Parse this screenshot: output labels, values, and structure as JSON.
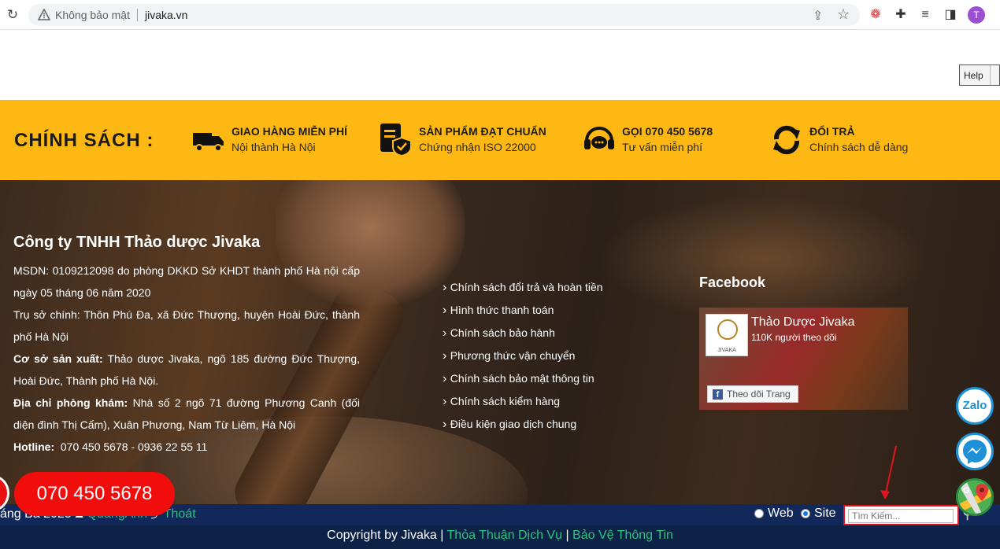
{
  "browser": {
    "security_label": "Không bảo mật",
    "url": "jivaka.vn",
    "avatar_initial": "T"
  },
  "help": {
    "label": "Help"
  },
  "policy": {
    "heading": "CHÍNH SÁCH :",
    "items": [
      {
        "icon": "truck-icon",
        "title": "GIAO HÀNG MIỄN PHÍ",
        "subtitle": "Nội thành Hà Nội"
      },
      {
        "icon": "certificate-icon",
        "title": "SẢN PHẨM ĐẠT CHUẨN",
        "subtitle": "Chứng nhận ISO 22000"
      },
      {
        "icon": "headset-icon",
        "title": "GỌI 070 450 5678",
        "subtitle": "Tư vấn miễn phí"
      },
      {
        "icon": "refresh-icon",
        "title": "ĐỔI TRẢ",
        "subtitle": "Chính sách dễ dàng"
      }
    ]
  },
  "company": {
    "name": "Công ty TNHH Thảo dược Jivaka",
    "msdn": "MSDN: 0109212098 do phòng DKKD Sở KHDT thành phố Hà nội cấp ngày 05 tháng 06 năm 2020",
    "head_office": "Trụ sở chính: Thôn Phú Đa, xã Đức Thượng, huyện Hoài Đức, thành phố Hà Nội",
    "factory_label": "Cơ sở sản xuất:",
    "factory": "Thảo dược Jivaka, ngõ 185 đường Đức Thượng, Hoài Đức, Thành phố Hà Nội.",
    "clinic_label": "Địa chỉ phòng khám:",
    "clinic": "Nhà số 2 ngõ 71 đường Phương Canh (đối diện đình Thị Cấm), Xuân Phương, Nam Từ Liêm, Hà Nội",
    "hotline_label": "Hotline:",
    "hotline": "070 450 5678 - 0936 22 55 11"
  },
  "links": [
    "Chính sách đổi trả và hoàn tiền",
    "Hình thức thanh toán",
    "Chính sách bảo hành",
    "Phương thức vận chuyển",
    "Chính sách bảo mật thông tin",
    "Chính sách kiểm hàng",
    "Điều kiện giao dịch chung"
  ],
  "facebook": {
    "title": "Facebook",
    "page_name": "Thảo Dược Jivaka",
    "followers": "110K người theo dõi",
    "logo_text": "JIVAKA",
    "follow_label": "Theo dõi Trang"
  },
  "bottom_bar": {
    "date_fragment": "áng Ba 2025",
    "user": "QuangAnh",
    "logout": "Thoát",
    "radio_web": "Web",
    "radio_site": "Site",
    "search_placeholder": "Tìm Kiếm..."
  },
  "copyright": {
    "text": "Copyright by Jivaka",
    "terms": "Thỏa Thuận Dịch Vụ",
    "privacy": "Bảo Vệ Thông Tin"
  },
  "floating": {
    "phone": "070 450 5678",
    "zalo": "Zalo"
  },
  "colors": {
    "policy_bg": "#fdb813",
    "bar_bg": "#12285a",
    "link_green": "#2ec27e",
    "phone_red": "#f20d0d",
    "highlight_red": "#e0141f"
  }
}
